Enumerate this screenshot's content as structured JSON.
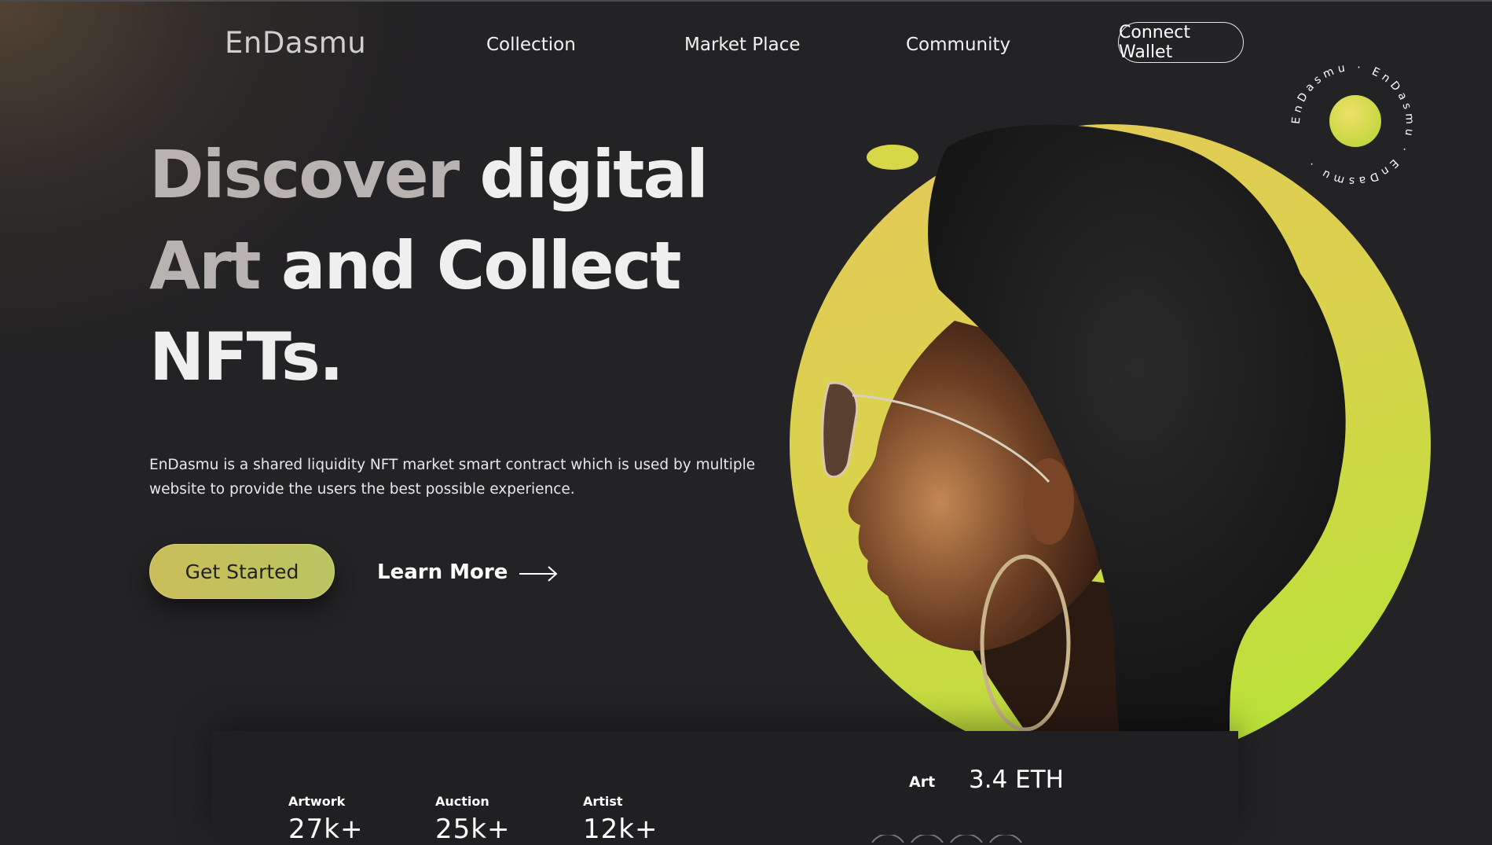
{
  "nav": {
    "logo": "EnDasmu",
    "links": [
      "Collection",
      "Market Place",
      "Community"
    ],
    "connect_wallet": "Connect Wallet"
  },
  "hero": {
    "title_lines": [
      "Discover digital",
      "Art and Collect",
      "NFTs."
    ],
    "title_muted_words": [
      "Discover",
      "Art"
    ],
    "description": "EnDasmu is a shared liquidity NFT market smart contract which is used by multiple website to provide the users the best possible experience.",
    "get_started": "Get Started",
    "learn_more": "Learn More"
  },
  "badge": {
    "text": "EnDasmu · EnDasmu · EnDasmu ·"
  },
  "stats": [
    {
      "label": "Artwork",
      "value": "27k+"
    },
    {
      "label": "Auction",
      "value": "25k+"
    },
    {
      "label": "Artist",
      "value": "12k+"
    }
  ],
  "featured": {
    "label": "Art",
    "price": "3.4 ETH"
  },
  "colors": {
    "background": "#232224",
    "accent_yellow": "#e6c85a",
    "accent_green": "#b2e634",
    "button_gradient_start": "#c9bd5a",
    "button_gradient_end": "#b9c561"
  },
  "icons": {
    "learn_more": "arrow-right-icon"
  }
}
